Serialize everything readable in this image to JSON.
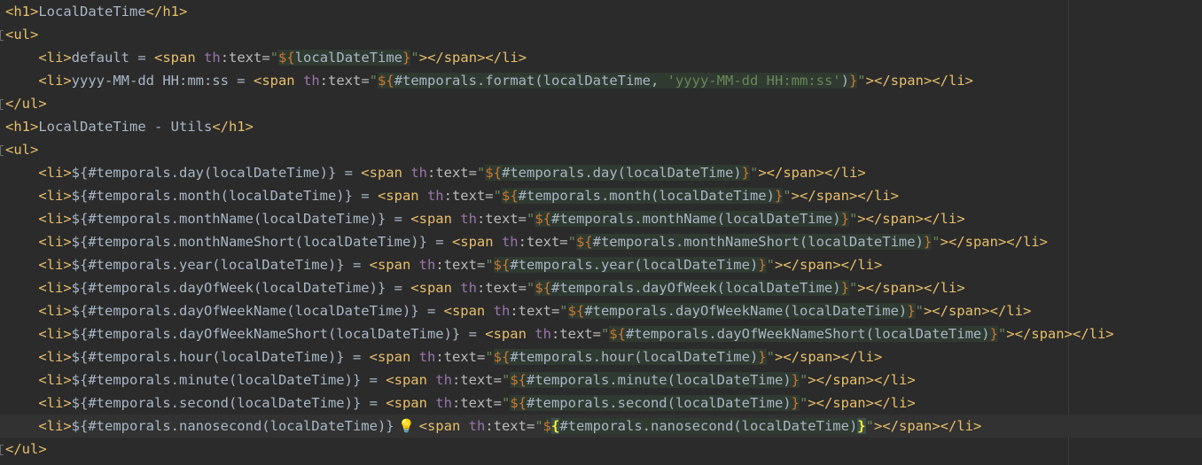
{
  "editor": {
    "lines": [
      {
        "indent": "",
        "text": "<h1>LocalDateTime</h1>"
      },
      {
        "indent": "",
        "text": "<ul>"
      },
      {
        "indent": "    ",
        "text": "<li>default = <span th:text=\"${localDateTime}\"></span></li>"
      },
      {
        "indent": "    ",
        "text": "<li>yyyy-MM-dd HH:mm:ss = <span th:text=\"${#temporals.format(localDateTime, 'yyyy-MM-dd HH:mm:ss')}\"></span></li>"
      },
      {
        "indent": "",
        "text": "</ul>"
      },
      {
        "indent": "",
        "text": "<h1>LocalDateTime - Utils</h1>"
      },
      {
        "indent": "",
        "text": "<ul>"
      },
      {
        "indent": "    ",
        "text": "<li>${#temporals.day(localDateTime)} = <span th:text=\"${#temporals.day(localDateTime)}\"></span></li>"
      },
      {
        "indent": "    ",
        "text": "<li>${#temporals.month(localDateTime)} = <span th:text=\"${#temporals.month(localDateTime)}\"></span></li>"
      },
      {
        "indent": "    ",
        "text": "<li>${#temporals.monthName(localDateTime)} = <span th:text=\"${#temporals.monthName(localDateTime)}\"></span></li>"
      },
      {
        "indent": "    ",
        "text": "<li>${#temporals.monthNameShort(localDateTime)} = <span th:text=\"${#temporals.monthNameShort(localDateTime)}\"></span></li>"
      },
      {
        "indent": "    ",
        "text": "<li>${#temporals.year(localDateTime)} = <span th:text=\"${#temporals.year(localDateTime)}\"></span></li>"
      },
      {
        "indent": "    ",
        "text": "<li>${#temporals.dayOfWeek(localDateTime)} = <span th:text=\"${#temporals.dayOfWeek(localDateTime)}\"></span></li>"
      },
      {
        "indent": "    ",
        "text": "<li>${#temporals.dayOfWeekName(localDateTime)} = <span th:text=\"${#temporals.dayOfWeekName(localDateTime)}\"></span></li>"
      },
      {
        "indent": "    ",
        "text": "<li>${#temporals.dayOfWeekNameShort(localDateTime)} = <span th:text=\"${#temporals.dayOfWeekNameShort(localDateTime)}\"></span></li>"
      },
      {
        "indent": "    ",
        "text": "<li>${#temporals.hour(localDateTime)} = <span th:text=\"${#temporals.hour(localDateTime)}\"></span></li>"
      },
      {
        "indent": "    ",
        "text": "<li>${#temporals.minute(localDateTime)} = <span th:text=\"${#temporals.minute(localDateTime)}\"></span></li>"
      },
      {
        "indent": "    ",
        "text": "<li>${#temporals.second(localDateTime)} = <span th:text=\"${#temporals.second(localDateTime)}\"></span></li>"
      },
      {
        "indent": "    ",
        "text": "<li>${#temporals.nanosecond(localDateTime)} <span th:text=\"${#temporals.nanosecond(localDateTime)}\"></span></li>"
      },
      {
        "indent": "",
        "text": "</ul>"
      }
    ],
    "current_line": 18,
    "intention_icon": "lightbulb-icon"
  },
  "colors": {
    "background": "#2b2b2b",
    "tag": "#e8bf6a",
    "text": "#a9b7c6",
    "attribute": "#bababa",
    "namespace": "#9876aa",
    "string": "#6a8759",
    "dollar": "#cc7832",
    "expression_bg": "#2f3a31",
    "current_line_bg": "#323232"
  }
}
